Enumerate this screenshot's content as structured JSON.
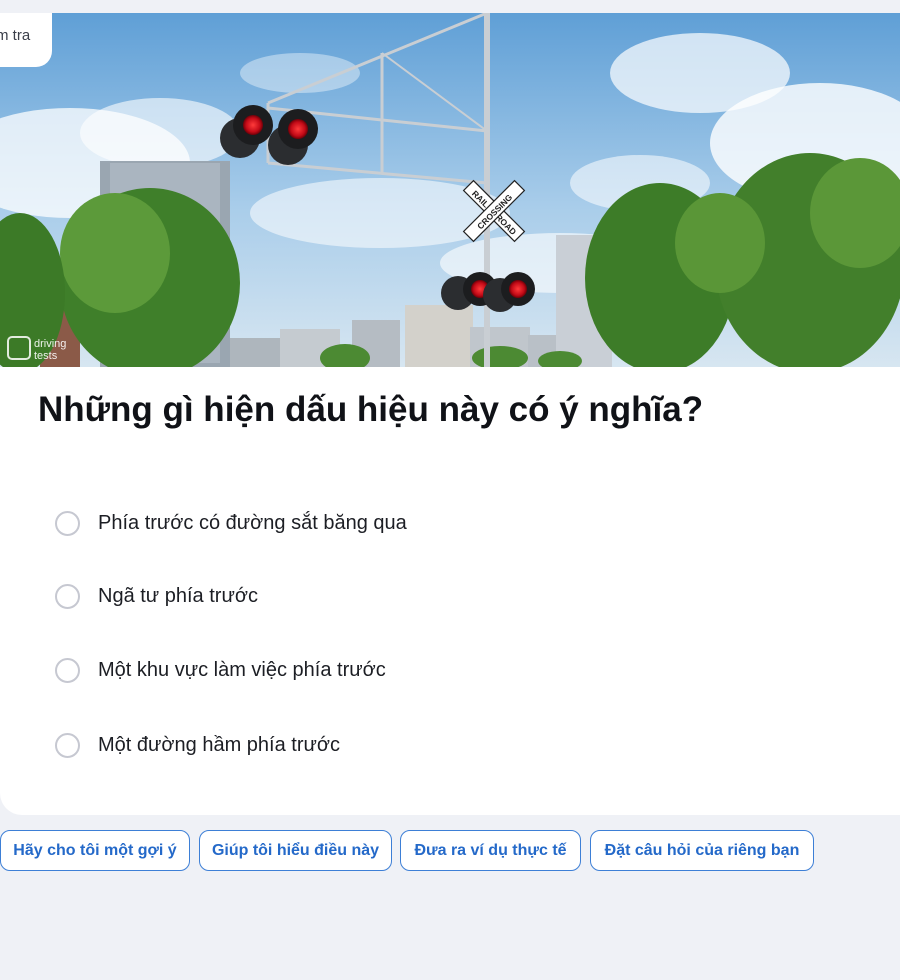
{
  "header": {
    "chip_label": "m tra",
    "watermark_line1": "driving",
    "watermark_line2": "tests"
  },
  "sign": {
    "arm1_text": "RAIL",
    "arm2_text": "ROAD",
    "arm3_text": "CROSSING"
  },
  "question": {
    "text": "Những gì hiện dấu hiệu này có ý nghĩa?",
    "options": [
      {
        "label": "Phía trước có đường sắt băng qua",
        "selected": false
      },
      {
        "label": "Ngã tư phía trước",
        "selected": false
      },
      {
        "label": "Một khu vực làm việc phía trước",
        "selected": false
      },
      {
        "label": "Một đường hầm phía trước",
        "selected": false
      }
    ]
  },
  "actions": [
    {
      "label": "Hãy cho tôi một gợi ý"
    },
    {
      "label": "Giúp tôi hiểu điều này"
    },
    {
      "label": "Đưa ra ví dụ thực tế"
    },
    {
      "label": "Đặt câu hỏi của riêng bạn"
    }
  ],
  "colors": {
    "page_background": "#eff1f6",
    "card_background": "#ffffff",
    "accent_blue": "#2469c9",
    "radio_border": "#c6c8d1",
    "signal_red": "#d0101c"
  }
}
